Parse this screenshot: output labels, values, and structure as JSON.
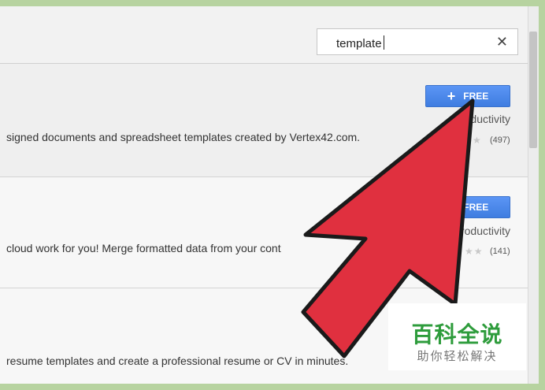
{
  "search": {
    "value": "template"
  },
  "results": [
    {
      "description": "signed documents and spreadsheet templates created by Vertex42.com.",
      "button_label": "FREE",
      "category": "Productivity",
      "stars": "★",
      "rating_count": "(497)"
    },
    {
      "description": "cloud work for you! Merge formatted data from your cont",
      "button_label": "FREE",
      "category": "Productivity",
      "stars": "★★",
      "rating_count": "(141)"
    },
    {
      "description": "resume templates and create a professional resume or CV in minutes.",
      "button_label": "",
      "category": "",
      "stars": "",
      "rating_count": ""
    }
  ],
  "watermark": {
    "title": "百科全说",
    "subtitle": "助你轻松解决"
  },
  "colors": {
    "button": "#4a86e8",
    "arrow": "#e0303f",
    "watermark_green": "#2e9c3c",
    "frame": "#b7d3a0"
  },
  "icons": {
    "clear": "close-icon",
    "add": "plus-icon",
    "rating": "star-icon",
    "pointer": "red-arrow-icon"
  }
}
